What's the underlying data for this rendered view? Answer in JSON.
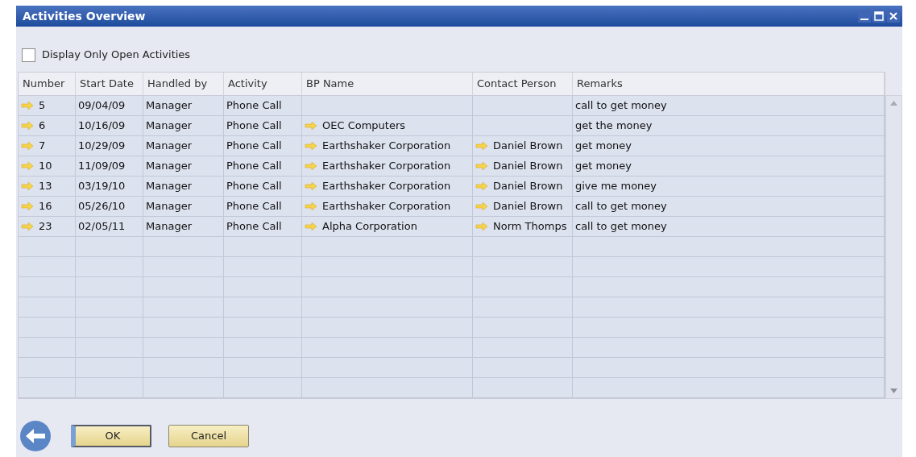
{
  "window": {
    "title": "Activities Overview"
  },
  "filter": {
    "label": "Display Only Open Activities",
    "checked": false
  },
  "table": {
    "columns": [
      {
        "label": "Number",
        "link": true
      },
      {
        "label": "Start Date",
        "link": false
      },
      {
        "label": "Handled by",
        "link": false
      },
      {
        "label": "Activity",
        "link": false
      },
      {
        "label": "BP Name",
        "link": true
      },
      {
        "label": "Contact Person",
        "link": true
      },
      {
        "label": "Remarks",
        "link": false
      }
    ],
    "rows": [
      [
        "5",
        "09/04/09",
        "Manager",
        "Phone Call",
        "",
        "",
        "call to get money"
      ],
      [
        "6",
        "10/16/09",
        "Manager",
        "Phone Call",
        "OEC Computers",
        "",
        "get the money"
      ],
      [
        "7",
        "10/29/09",
        "Manager",
        "Phone Call",
        "Earthshaker Corporation",
        "Daniel Brown",
        "get money"
      ],
      [
        "10",
        "11/09/09",
        "Manager",
        "Phone Call",
        "Earthshaker Corporation",
        "Daniel Brown",
        "get money"
      ],
      [
        "13",
        "03/19/10",
        "Manager",
        "Phone Call",
        "Earthshaker Corporation",
        "Daniel Brown",
        "give me money"
      ],
      [
        "16",
        "05/26/10",
        "Manager",
        "Phone Call",
        "Earthshaker Corporation",
        "Daniel Brown",
        "call to get money"
      ],
      [
        "23",
        "02/05/11",
        "Manager",
        "Phone Call",
        "Alpha Corporation",
        "Norm Thomps",
        "call to get money"
      ]
    ]
  },
  "buttons": [
    {
      "label": "OK",
      "selected": true
    },
    {
      "label": "Cancel",
      "selected": false
    }
  ]
}
